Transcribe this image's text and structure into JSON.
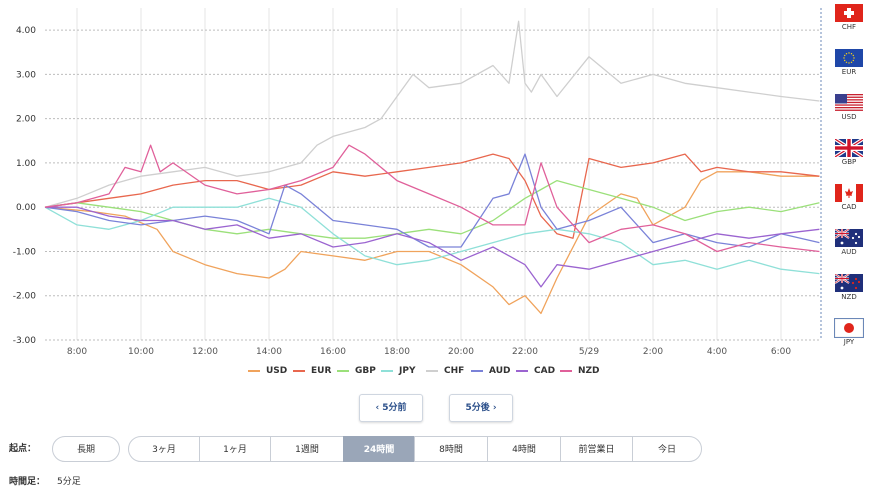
{
  "chart_data": {
    "type": "line",
    "ylim": [
      -3.0,
      4.5
    ],
    "y_ticks": [
      "4.00",
      "3.00",
      "2.00",
      "1.00",
      "0.00",
      "-1.00",
      "-2.00",
      "-3.00"
    ],
    "y_tick_values": [
      4,
      3,
      2,
      1,
      0,
      -1,
      -2,
      -3
    ],
    "x_ticks": [
      "8:00",
      "10:00",
      "12:00",
      "14:00",
      "16:00",
      "18:00",
      "20:00",
      "22:00",
      "5/29",
      "2:00",
      "4:00",
      "6:00"
    ],
    "x_tick_hours": [
      8,
      10,
      12,
      14,
      16,
      18,
      20,
      22,
      24,
      26,
      28,
      30
    ],
    "x_range_hours": [
      7.0,
      31.25
    ],
    "grid": true,
    "legend_position": "bottom",
    "series": [
      {
        "name": "USD",
        "color": "#f0a35c",
        "x": [
          7,
          8.5,
          9.5,
          10.5,
          11,
          12,
          13,
          14,
          14.5,
          15,
          16,
          17,
          18,
          19,
          20,
          21,
          21.5,
          22,
          22.5,
          23,
          24,
          25,
          25.5,
          26,
          27,
          27.5,
          28,
          29,
          30,
          31.2
        ],
        "values": [
          0.0,
          -0.1,
          -0.2,
          -0.5,
          -1.0,
          -1.3,
          -1.5,
          -1.6,
          -1.4,
          -1.0,
          -1.1,
          -1.2,
          -1.0,
          -1.0,
          -1.3,
          -1.8,
          -2.2,
          -2.0,
          -2.4,
          -1.6,
          -0.2,
          0.3,
          0.2,
          -0.4,
          0.0,
          0.6,
          0.8,
          0.8,
          0.7,
          0.7
        ]
      },
      {
        "name": "EUR",
        "color": "#e8674e",
        "x": [
          7,
          8,
          9,
          10,
          11,
          12,
          13,
          14,
          15,
          16,
          17,
          18,
          19,
          20,
          21,
          21.5,
          22,
          22.5,
          23,
          23.5,
          24,
          25,
          26,
          27,
          27.5,
          28,
          29,
          30,
          31.2
        ],
        "values": [
          0.0,
          0.1,
          0.2,
          0.3,
          0.5,
          0.6,
          0.6,
          0.4,
          0.5,
          0.8,
          0.7,
          0.8,
          0.9,
          1.0,
          1.2,
          1.1,
          0.6,
          -0.2,
          -0.6,
          -0.7,
          1.1,
          0.9,
          1.0,
          1.2,
          0.8,
          0.9,
          0.8,
          0.8,
          0.7
        ]
      },
      {
        "name": "GBP",
        "color": "#9be07a",
        "x": [
          7,
          8,
          9,
          10,
          11,
          12,
          13,
          14,
          15,
          16,
          17,
          18,
          19,
          20,
          21,
          22,
          22.5,
          23,
          24,
          25,
          26,
          27,
          28,
          29,
          30,
          31.2
        ],
        "values": [
          0.0,
          0.1,
          0.0,
          -0.1,
          -0.3,
          -0.5,
          -0.6,
          -0.5,
          -0.6,
          -0.7,
          -0.7,
          -0.6,
          -0.5,
          -0.6,
          -0.3,
          0.2,
          0.4,
          0.6,
          0.4,
          0.2,
          0.0,
          -0.3,
          -0.1,
          0.0,
          -0.1,
          0.1
        ]
      },
      {
        "name": "JPY",
        "color": "#8fe0d8",
        "x": [
          7,
          8,
          9,
          10,
          11,
          12,
          13,
          14,
          15,
          16,
          17,
          18,
          19,
          20,
          21,
          22,
          23,
          24,
          25,
          26,
          27,
          28,
          29,
          30,
          31.2
        ],
        "values": [
          0.0,
          -0.4,
          -0.5,
          -0.3,
          0.0,
          0.0,
          0.0,
          0.2,
          0.0,
          -0.6,
          -1.1,
          -1.3,
          -1.2,
          -1.0,
          -0.8,
          -0.6,
          -0.5,
          -0.6,
          -0.8,
          -1.3,
          -1.2,
          -1.4,
          -1.2,
          -1.4,
          -1.5
        ]
      },
      {
        "name": "CHF",
        "color": "#cfcfcf",
        "x": [
          7,
          8,
          9,
          10,
          11,
          12,
          13,
          14,
          15,
          15.5,
          16,
          17,
          17.5,
          18,
          18.5,
          19,
          20,
          21,
          21.5,
          21.8,
          22,
          22.2,
          22.5,
          23,
          24,
          25,
          26,
          27,
          28,
          29,
          30,
          31.2
        ],
        "values": [
          0.0,
          0.2,
          0.5,
          0.7,
          0.8,
          0.9,
          0.7,
          0.8,
          1.0,
          1.4,
          1.6,
          1.8,
          2.0,
          2.5,
          3.0,
          2.7,
          2.8,
          3.2,
          2.8,
          4.2,
          2.8,
          2.6,
          3.0,
          2.5,
          3.4,
          2.8,
          3.0,
          2.8,
          2.7,
          2.6,
          2.5,
          2.4
        ]
      },
      {
        "name": "AUD",
        "color": "#7a82d8",
        "x": [
          7,
          8,
          9,
          10,
          11,
          12,
          13,
          14,
          14.5,
          15,
          16,
          17,
          18,
          19,
          20,
          21,
          21.5,
          22,
          22.5,
          23,
          24,
          25,
          26,
          27,
          28,
          29,
          30,
          31.2
        ],
        "values": [
          0.0,
          -0.1,
          -0.3,
          -0.4,
          -0.3,
          -0.2,
          -0.3,
          -0.6,
          0.5,
          0.3,
          -0.3,
          -0.4,
          -0.5,
          -0.9,
          -0.9,
          0.2,
          0.3,
          1.2,
          0.0,
          -0.5,
          -0.3,
          0.0,
          -0.8,
          -0.6,
          -0.8,
          -0.9,
          -0.6,
          -0.8
        ]
      },
      {
        "name": "CAD",
        "color": "#9b64d0",
        "x": [
          7,
          8,
          9,
          10,
          11,
          12,
          13,
          14,
          15,
          16,
          17,
          18,
          19,
          20,
          21,
          22,
          22.5,
          23,
          24,
          25,
          26,
          27,
          28,
          29,
          30,
          31.2
        ],
        "values": [
          0.0,
          0.0,
          -0.2,
          -0.3,
          -0.3,
          -0.5,
          -0.4,
          -0.7,
          -0.6,
          -0.9,
          -0.8,
          -0.6,
          -0.8,
          -1.2,
          -0.9,
          -1.3,
          -1.8,
          -1.3,
          -1.4,
          -1.2,
          -1.0,
          -0.8,
          -0.6,
          -0.7,
          -0.6,
          -0.5
        ]
      },
      {
        "name": "NZD",
        "color": "#e0609a",
        "x": [
          7,
          8,
          9,
          9.5,
          10,
          10.3,
          10.6,
          11,
          12,
          13,
          14,
          15,
          16,
          16.5,
          17,
          18,
          19,
          20,
          21,
          22,
          22.5,
          23,
          24,
          25,
          26,
          27,
          28,
          29,
          30,
          31.2
        ],
        "values": [
          0.0,
          0.1,
          0.3,
          0.9,
          0.8,
          1.4,
          0.8,
          1.0,
          0.5,
          0.3,
          0.4,
          0.6,
          0.9,
          1.4,
          1.2,
          0.6,
          0.3,
          0.0,
          -0.4,
          -0.4,
          1.0,
          0.0,
          -0.8,
          -0.5,
          -0.4,
          -0.6,
          -1.0,
          -0.8,
          -0.9,
          -1.0
        ]
      }
    ]
  },
  "flags": [
    {
      "code": "CHF",
      "type": "chf"
    },
    {
      "code": "EUR",
      "type": "eur"
    },
    {
      "code": "USD",
      "type": "usd"
    },
    {
      "code": "GBP",
      "type": "gbp"
    },
    {
      "code": "CAD",
      "type": "cad"
    },
    {
      "code": "AUD",
      "type": "aud"
    },
    {
      "code": "NZD",
      "type": "nzd"
    },
    {
      "code": "JPY",
      "type": "jpy"
    }
  ],
  "nav": {
    "prev_label": "‹ 5分前",
    "next_label": "5分後 ›"
  },
  "range": {
    "label": "起点：",
    "options": [
      "長期",
      "3ヶ月",
      "1ヶ月",
      "1週間",
      "24時間",
      "8時間",
      "4時間",
      "前営業日",
      "今日"
    ],
    "selected": "24時間"
  },
  "interval": {
    "label": "時間足：",
    "value": "5分足"
  }
}
